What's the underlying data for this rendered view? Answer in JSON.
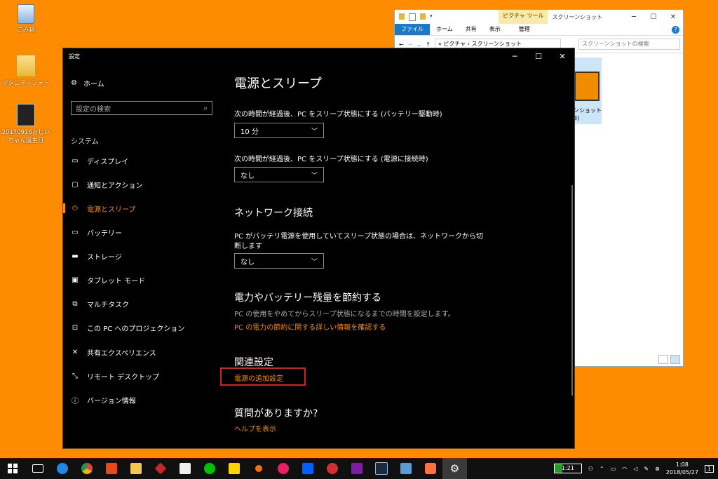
{
  "desktop": {
    "icons": [
      {
        "label": "ごみ箱"
      },
      {
        "label": "マタニティフォト"
      },
      {
        "label": "20170916おじいちゃん誕生日"
      }
    ]
  },
  "explorer": {
    "picture_tools": "ピクチャ ツール",
    "title": "スクリーンショット",
    "tabs": [
      "ファイル",
      "ホーム",
      "共有",
      "表示",
      "管理"
    ],
    "path": "« ピクチャ › スクリーンショット",
    "search_placeholder": "スクリーンショットの検索",
    "file_caption": "ンショット",
    "file_caption2": "3)",
    "help": "?"
  },
  "settings": {
    "window_title": "設定",
    "nav": {
      "home": "ホーム",
      "search_placeholder": "設定の検索",
      "section": "システム",
      "items": [
        {
          "label": "ディスプレイ"
        },
        {
          "label": "通知とアクション"
        },
        {
          "label": "電源とスリープ"
        },
        {
          "label": "バッテリー"
        },
        {
          "label": "ストレージ"
        },
        {
          "label": "タブレット モード"
        },
        {
          "label": "マルチタスク"
        },
        {
          "label": "この PC へのプロジェクション"
        },
        {
          "label": "共有エクスペリエンス"
        },
        {
          "label": "リモート デスクトップ"
        },
        {
          "label": "バージョン情報"
        }
      ]
    },
    "content": {
      "title": "電源とスリープ",
      "sleep_battery_label": "次の時間が経過後、PC をスリープ状態にする (バッテリー駆動時)",
      "sleep_battery_value": "10 分",
      "sleep_plugged_label": "次の時間が経過後、PC をスリープ状態にする (電源に接続時)",
      "sleep_plugged_value": "なし",
      "network_title": "ネットワーク接続",
      "network_desc_line1": "PC がバッテリ電源を使用していてスリープ状態の場合は、ネットワークから切",
      "network_desc_line2": "断します",
      "network_value": "なし",
      "save_title": "電力やバッテリー残量を節約する",
      "save_desc": "PC の使用をやめてからスリープ状態になるまでの時間を設定します。",
      "save_link": "PC の電力の節約に関する詳しい情報を確認する",
      "related_title": "関連設定",
      "related_link": "電源の追加設定",
      "question_title": "質問がありますか?",
      "help_link": "ヘルプを表示"
    }
  },
  "taskbar": {
    "battery_text": "1:21",
    "time": "1:08",
    "date": "2018/05/27",
    "notifications": "1"
  },
  "colors": {
    "desktop": "#ff8c00",
    "accent": "#ff8c00",
    "highlight_box": "#d42020"
  }
}
